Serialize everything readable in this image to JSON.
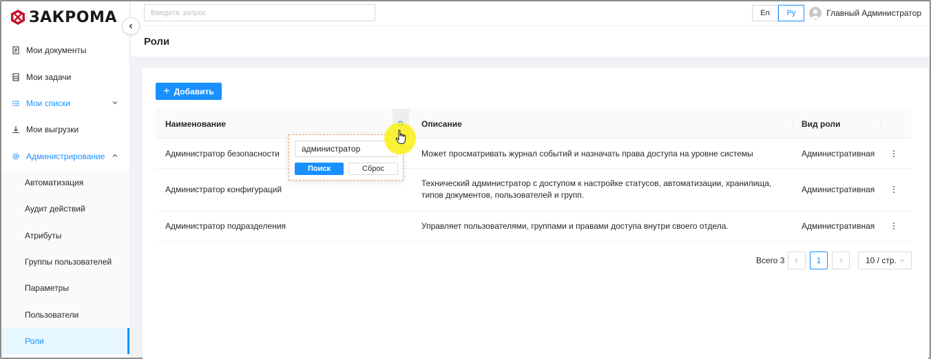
{
  "app": {
    "logo_text": "ЗАКРОМА"
  },
  "header": {
    "search_placeholder": "Введите запрос",
    "lang_en": "En",
    "lang_ru": "Ру",
    "active_lang": "Ру",
    "user_name": "Главный Администратор"
  },
  "sidebar": {
    "items": [
      {
        "label": "Мои документы",
        "icon": "document-icon"
      },
      {
        "label": "Мои задачи",
        "icon": "tasks-icon"
      },
      {
        "label": "Мои списки",
        "icon": "list-icon",
        "expandable": true
      },
      {
        "label": "Мои выгрузки",
        "icon": "download-icon"
      },
      {
        "label": "Администрирование",
        "icon": "settings-icon",
        "expanded": true
      }
    ],
    "admin_sub_items": [
      {
        "label": "Автоматизация"
      },
      {
        "label": "Аудит действий"
      },
      {
        "label": "Атрибуты"
      },
      {
        "label": "Группы пользователей"
      },
      {
        "label": "Параметры"
      },
      {
        "label": "Пользователи"
      },
      {
        "label": "Роли",
        "active": true
      }
    ]
  },
  "page": {
    "title": "Роли",
    "add_button": "Добавить"
  },
  "table": {
    "columns": [
      "Наименование",
      "Описание",
      "Вид роли"
    ],
    "rows": [
      {
        "name": "Администратор безопасности",
        "description": "Может просматривать журнал событий и назначать права доступа на уровне системы",
        "type": "Административная"
      },
      {
        "name": "Администратор конфигураций",
        "description": "Технический администратор с доступом к настройке статусов, автоматизации, хранилища, типов документов, пользователей и групп.",
        "type": "Административная"
      },
      {
        "name": "Администратор подразделения",
        "description": "Управляет пользователями, группами и правами доступа внутри своего отдела.",
        "type": "Административная"
      }
    ]
  },
  "filter": {
    "value": "администратор",
    "search_button": "Поиск",
    "reset_button": "Сброс"
  },
  "pagination": {
    "total": "Всего 3",
    "current_page": "1",
    "page_size": "10 / стр."
  },
  "colors": {
    "accent": "#1890ff",
    "cursor_highlight": "#faf014",
    "filter_border": "#f5a06a"
  }
}
